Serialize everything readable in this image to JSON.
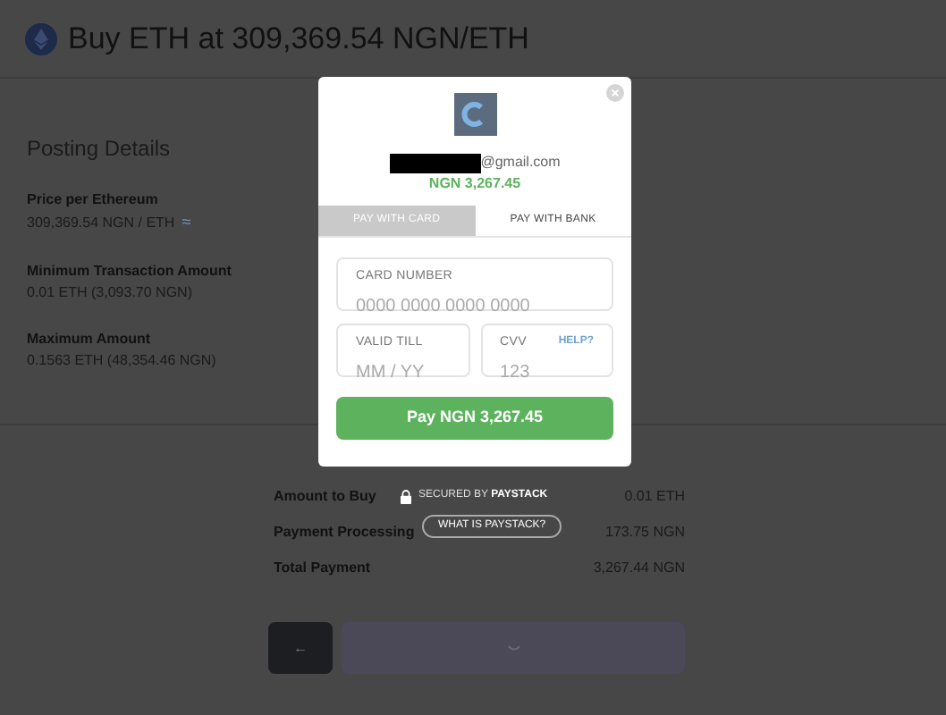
{
  "header": {
    "title": "Buy ETH at 309,369.54 NGN/ETH"
  },
  "details": {
    "heading": "Posting Details",
    "items": [
      {
        "label": "Price per Ethereum",
        "value": "309,369.54 NGN / ETH",
        "approx": "≈"
      },
      {
        "label": "Minimum Transaction Amount",
        "value": "0.01 ETH (3,093.70 NGN)"
      },
      {
        "label": "Maximum Amount",
        "value": "0.1563 ETH (48,354.46 NGN)"
      }
    ]
  },
  "summary": [
    {
      "label": "Amount to Buy",
      "value": "0.01 ETH"
    },
    {
      "label": "Payment Processing",
      "value": "173.75 NGN"
    },
    {
      "label": "Total Payment",
      "value": "3,267.44 NGN"
    }
  ],
  "back_button": {
    "label": "←"
  },
  "modal": {
    "email": "@gmail.com",
    "amount": "NGN 3,267.45",
    "tabs": [
      {
        "label": "PAY WITH CARD",
        "selected": true
      },
      {
        "label": "PAY WITH BANK",
        "selected": false
      }
    ],
    "card_number": {
      "label": "CARD NUMBER",
      "placeholder": "0000 0000 0000 0000"
    },
    "valid_till": {
      "label": "VALID TILL",
      "placeholder": "MM / YY"
    },
    "cvv": {
      "label": "CVV",
      "placeholder": "123",
      "help": "HELP?"
    },
    "pay_button": "Pay NGN 3,267.45"
  },
  "secured": {
    "prefix": "SECURED BY",
    "brand": "PAYSTACK"
  },
  "what_is_button": "WHAT IS PAYSTACK?"
}
